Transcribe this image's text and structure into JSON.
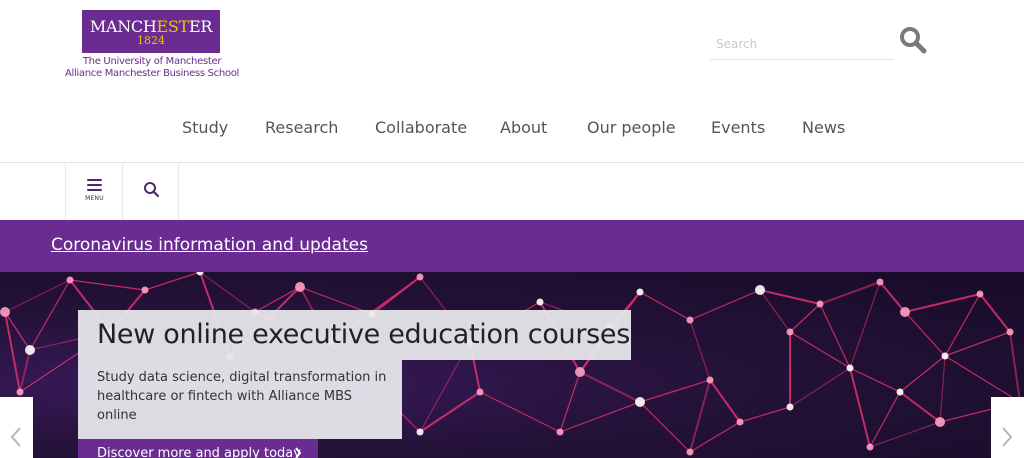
{
  "header": {
    "logo": {
      "word_start": "MANCH",
      "word_highlight": "EST",
      "word_end": "ER",
      "year": "1824",
      "line1": "The University of Manchester",
      "line2": "Alliance Manchester Business School"
    },
    "search": {
      "placeholder": "Search",
      "value": "",
      "icon": "search-icon"
    }
  },
  "nav": {
    "items": [
      {
        "label": "Study"
      },
      {
        "label": "Research"
      },
      {
        "label": "Collaborate"
      },
      {
        "label": "About"
      },
      {
        "label": "Our people"
      },
      {
        "label": "Events"
      },
      {
        "label": "News"
      }
    ]
  },
  "utility": {
    "menu_label": "MENU",
    "menu_icon": "menu-icon",
    "search_icon": "search-icon"
  },
  "alert": {
    "link_text": "Coronavirus information and updates"
  },
  "hero": {
    "title": "New online executive education courses",
    "description": "Study data science, digital transformation in healthcare or fintech with Alliance MBS online",
    "cta_label": "Discover more and apply today",
    "cta_icon": "chevron-right-icon",
    "prev_icon": "chevron-left-icon",
    "next_icon": "chevron-right-icon"
  },
  "colors": {
    "brand_purple": "#6a2c91",
    "logo_gold": "#f2c400",
    "hero_line": "#e0306e",
    "hero_dark": "#1d0f30"
  }
}
